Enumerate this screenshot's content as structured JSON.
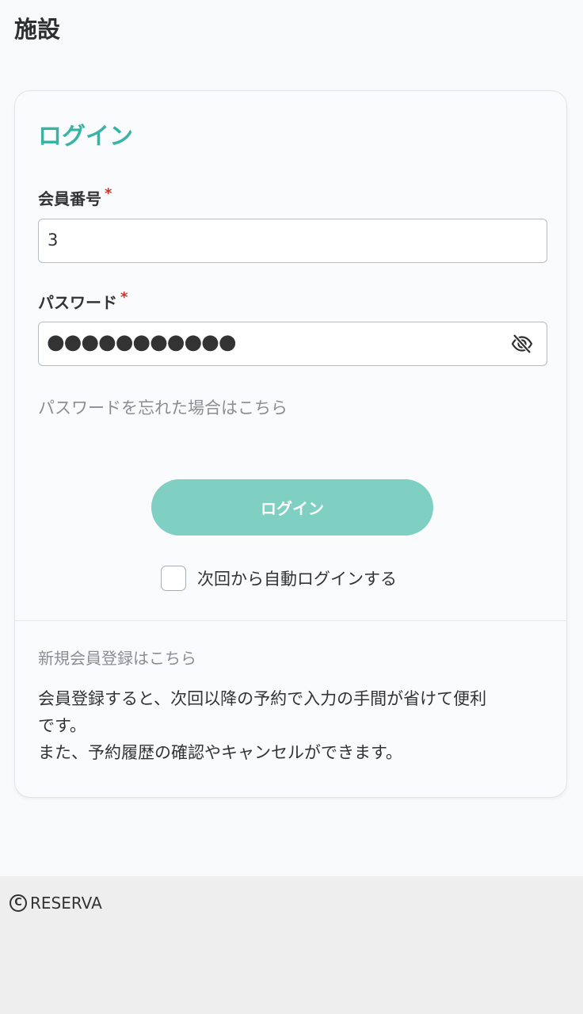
{
  "header": {
    "title": "施設"
  },
  "login": {
    "heading": "ログイン",
    "member_number": {
      "label": "会員番号",
      "required_mark": "*",
      "value": "3"
    },
    "password": {
      "label": "パスワード",
      "required_mark": "*",
      "masked_value": "●●●●●●●●●●●",
      "toggle_icon": "eye-slash-icon"
    },
    "forgot_password_link": "パスワードを忘れた場合はこちら",
    "submit_label": "ログイン",
    "auto_login": {
      "label": "次回から自動ログインする",
      "checked": false
    }
  },
  "register": {
    "link": "新規会員登録はこちら",
    "description_lines": [
      "会員登録すると、次回以降の予約で入力の手間が省けて便利",
      "です。",
      "また、予約履歴の確認やキャンセルができます。"
    ]
  },
  "footer": {
    "copyright_symbol": "C",
    "brand": "RESERVA"
  },
  "colors": {
    "accent": "#3bb3a4",
    "button": "#7fcfc2",
    "required": "#c0392b",
    "link": "#8a8e94"
  }
}
